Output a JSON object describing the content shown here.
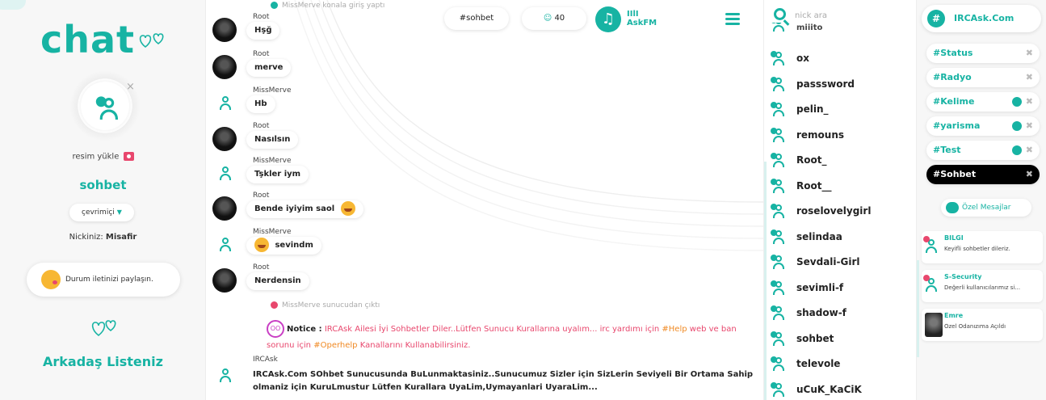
{
  "profile": {
    "logo": "chat",
    "upload_label": "resim yükle",
    "room_name": "sohbet",
    "status_label": "çevrimiçi",
    "nick_label": "Nickiniz:",
    "nick_value": "Misafir",
    "share_label": "Durum iletinizi paylaşın.",
    "friends_title": "Arkadaş Listeniz"
  },
  "topbar": {
    "room_pill": "#sohbet",
    "user_count": "40",
    "brand_line1": "IIlI",
    "brand_line2": "AskFM"
  },
  "chat": {
    "join_notice": "MissMerve konala giriş yaptı",
    "messages": [
      {
        "author": "Root",
        "text": "Hşğ",
        "avatar": "photo"
      },
      {
        "author": "Root",
        "text": "merve",
        "avatar": "photo"
      },
      {
        "author": "MissMerve",
        "text": "Hb",
        "avatar": "user"
      },
      {
        "author": "Root",
        "text": "Nasılsın",
        "avatar": "photo"
      },
      {
        "author": "MissMerve",
        "text": "Tşkler iym",
        "avatar": "user"
      },
      {
        "author": "Root",
        "text": "Bende iyiyim saol",
        "avatar": "photo",
        "emoji": true
      },
      {
        "author": "MissMerve",
        "text": "sevindm",
        "avatar": "user",
        "emoji_before": true
      },
      {
        "author": "Root",
        "text": "Nerdensin",
        "avatar": "photo"
      }
    ],
    "quit_notice": "MissMerve sunucudan çıktı",
    "notice": {
      "label": "Notice :",
      "text1": "IRCAsk Ailesi İyi Sohbetler Diler..Lütfen Sunucu Kurallarına uyalım... irc yardımı için",
      "help1": "#Help",
      "text2": "web ve ban sorunu için",
      "help2": "#Operhelp",
      "text3": "Kanallarını Kullanabilirsiniz."
    },
    "irc": {
      "author": "IRCAsk",
      "text": "IRCAsk.Com SOhbet Sunucusunda BuLunmaktasiniz..Sunucumuz Sizler için SizLerin Seviyeli Bir Ortama Sahip olmaniz için KuruLmustur Lütfen Kurallara UyaLim,Uymayanlari UyaraLim..."
    }
  },
  "userlist": {
    "search_placeholder": "nick ara",
    "partial_top": "miiito",
    "users": [
      "ox",
      "passsword",
      "pelin_",
      "remouns",
      "Root_",
      "Root__",
      "roselovelygirl",
      "selindaa",
      "Sevdali-Girl",
      "sevimli-f",
      "shadow-f",
      "sohbet",
      "televole",
      "uCuK_KaCiK"
    ]
  },
  "rooms": {
    "header": "IRCAsk.Com",
    "list": [
      {
        "name": "#Status",
        "active": false,
        "count": false
      },
      {
        "name": "#Radyo",
        "active": false,
        "count": false
      },
      {
        "name": "#Kelime",
        "active": false,
        "count": true
      },
      {
        "name": "#yarisma",
        "active": false,
        "count": true
      },
      {
        "name": "#Test",
        "active": false,
        "count": true
      },
      {
        "name": "#Sohbet",
        "active": true,
        "count": false
      }
    ],
    "pm_button": "Özel Mesajlar",
    "pms": [
      {
        "who": "BILGI",
        "text": "Keyifli sohbetler dileriz."
      },
      {
        "who": "S-Security",
        "text": "Değerli kullanıcılarımız si..."
      },
      {
        "who": "Emre",
        "text": "Özel Odanızıma Açıldı"
      }
    ]
  },
  "colors": {
    "accent": "#17b3a3",
    "notice": "#e8476d",
    "highlight": "#f08a24"
  }
}
